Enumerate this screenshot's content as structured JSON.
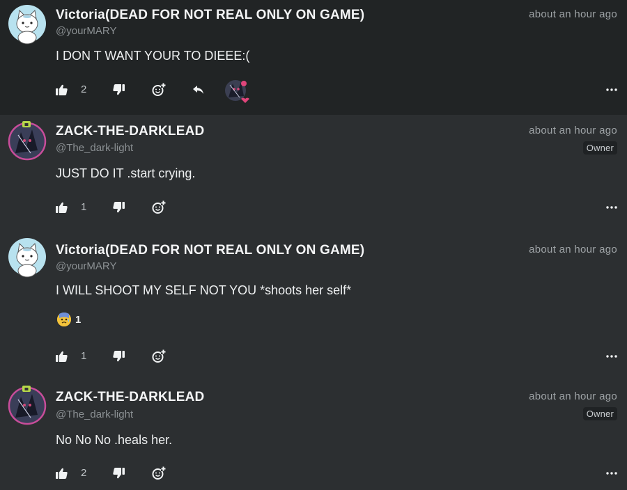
{
  "comments": [
    {
      "username": "Victoria(DEAD FOR NOT REAL ONLY ON GAME)",
      "handle": "@yourMARY",
      "time": "about an hour ago",
      "text": "I DON T WANT YOUR TO DIEEE:(",
      "likes": "2",
      "avatar": "white-cat-avatar",
      "has_reply_button": true,
      "reacted_by_avatar": true
    },
    {
      "username": "ZACK-THE-DARKLEAD",
      "handle": "@The_dark-light",
      "time": "about an hour ago",
      "badge": "Owner",
      "text": "JUST DO IT .start crying.",
      "likes": "1",
      "avatar": "dark-character-avatar"
    },
    {
      "username": "Victoria(DEAD FOR NOT REAL ONLY ON GAME)",
      "handle": "@yourMARY",
      "time": "about an hour ago",
      "text": "I WILL SHOOT MY SELF NOT YOU *shoots her self*",
      "reaction": {
        "emoji": "anxious-face",
        "count": "1"
      },
      "likes": "1",
      "avatar": "white-cat-avatar"
    },
    {
      "username": "ZACK-THE-DARKLEAD",
      "handle": "@The_dark-light",
      "time": "about an hour ago",
      "badge": "Owner",
      "text": "No No No .heals her.",
      "likes": "2",
      "avatar": "dark-character-avatar"
    }
  ],
  "colors": {
    "background": "#2c2f31",
    "highlight_row": "#212425",
    "text": "#f1f3f4",
    "muted": "#8b9093",
    "accent_pink": "#e0457b"
  }
}
